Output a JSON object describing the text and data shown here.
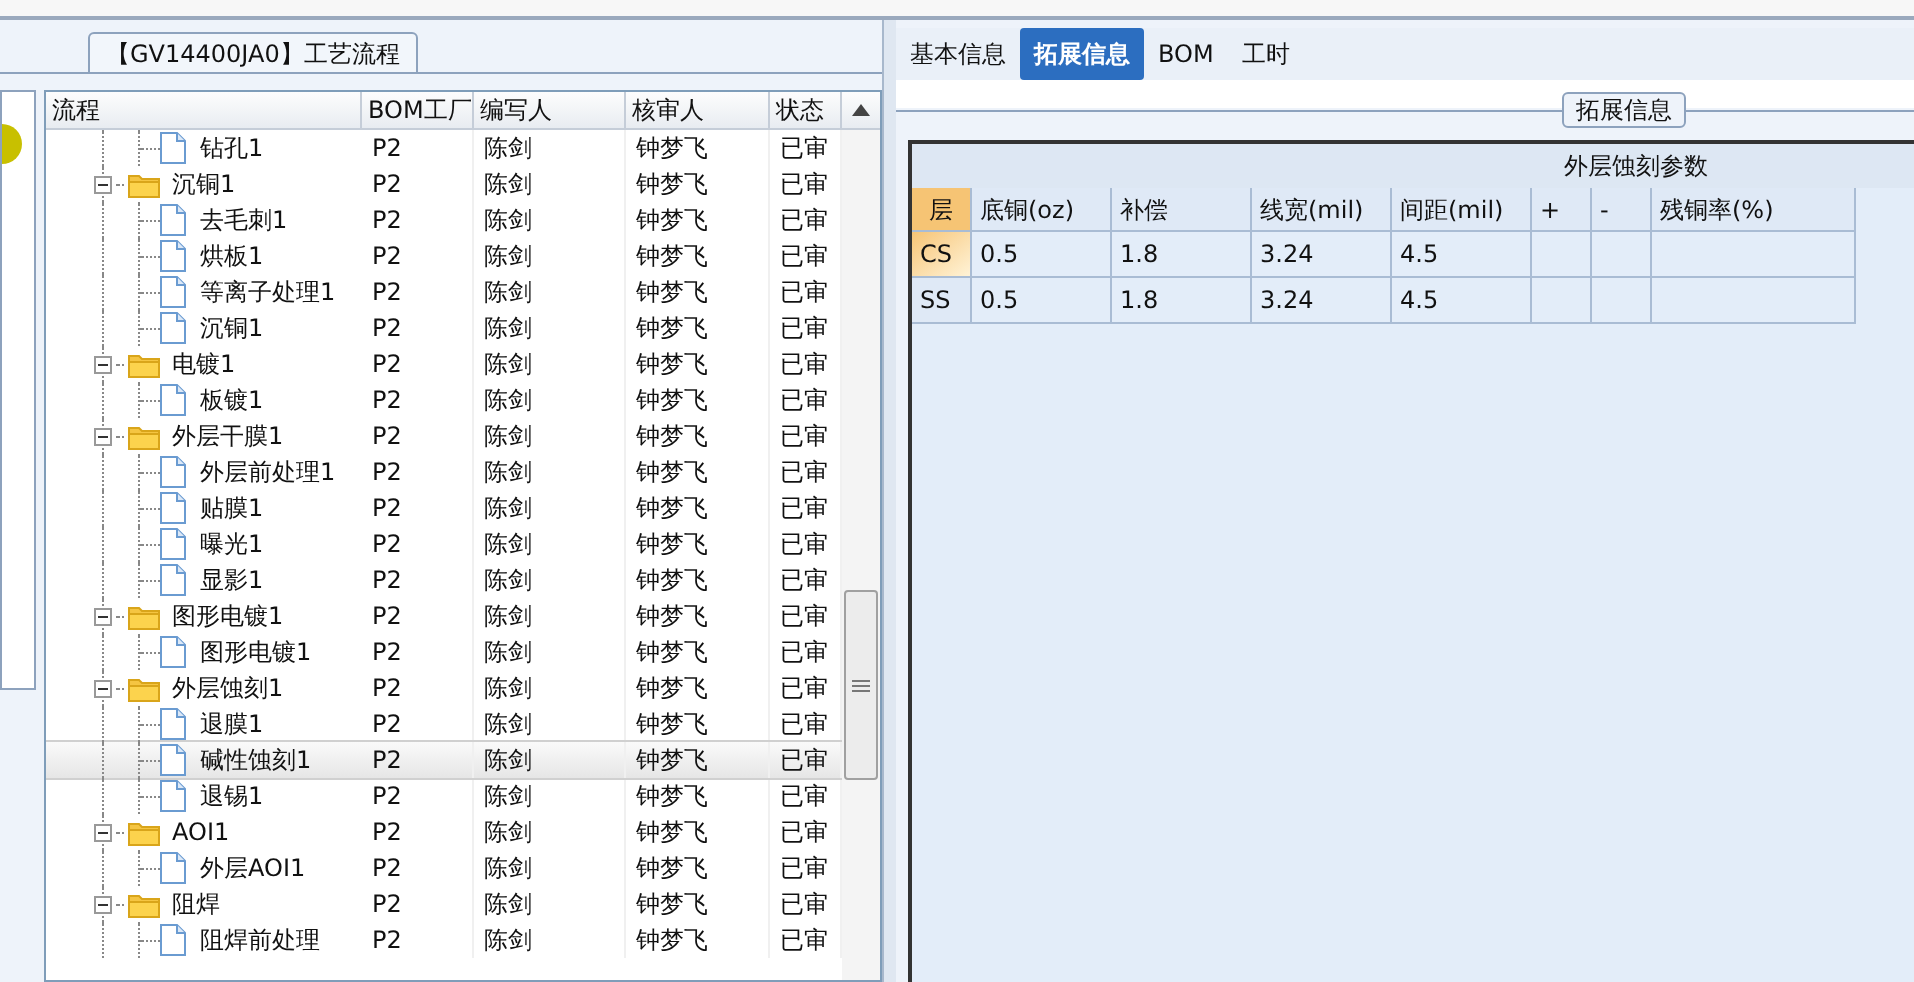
{
  "process_panel": {
    "title": "【GV14400JA0】工艺流程",
    "columns": [
      "流程",
      "BOM工厂",
      "编写人",
      "核审人",
      "状态"
    ],
    "rows": [
      {
        "kind": "continuation",
        "children": [
          {
            "kind": "file",
            "name": "钻孔1",
            "bom_factory": "P2",
            "author": "陈剑",
            "reviewer": "钟梦飞",
            "status": "已审",
            "selected": false
          }
        ]
      },
      {
        "kind": "folder",
        "name": "沉铜1",
        "bom_factory": "P2",
        "author": "陈剑",
        "reviewer": "钟梦飞",
        "status": "已审",
        "expanded": true,
        "selected": false,
        "children": [
          {
            "kind": "file",
            "name": "去毛刺1",
            "bom_factory": "P2",
            "author": "陈剑",
            "reviewer": "钟梦飞",
            "status": "已审",
            "selected": false
          },
          {
            "kind": "file",
            "name": "烘板1",
            "bom_factory": "P2",
            "author": "陈剑",
            "reviewer": "钟梦飞",
            "status": "已审",
            "selected": false
          },
          {
            "kind": "file",
            "name": "等离子处理1",
            "bom_factory": "P2",
            "author": "陈剑",
            "reviewer": "钟梦飞",
            "status": "已审",
            "selected": false
          },
          {
            "kind": "file",
            "name": "沉铜1",
            "bom_factory": "P2",
            "author": "陈剑",
            "reviewer": "钟梦飞",
            "status": "已审",
            "selected": false
          }
        ]
      },
      {
        "kind": "folder",
        "name": "电镀1",
        "bom_factory": "P2",
        "author": "陈剑",
        "reviewer": "钟梦飞",
        "status": "已审",
        "expanded": true,
        "selected": false,
        "children": [
          {
            "kind": "file",
            "name": "板镀1",
            "bom_factory": "P2",
            "author": "陈剑",
            "reviewer": "钟梦飞",
            "status": "已审",
            "selected": false
          }
        ]
      },
      {
        "kind": "folder",
        "name": "外层干膜1",
        "bom_factory": "P2",
        "author": "陈剑",
        "reviewer": "钟梦飞",
        "status": "已审",
        "expanded": true,
        "selected": false,
        "children": [
          {
            "kind": "file",
            "name": "外层前处理1",
            "bom_factory": "P2",
            "author": "陈剑",
            "reviewer": "钟梦飞",
            "status": "已审",
            "selected": false
          },
          {
            "kind": "file",
            "name": "贴膜1",
            "bom_factory": "P2",
            "author": "陈剑",
            "reviewer": "钟梦飞",
            "status": "已审",
            "selected": false
          },
          {
            "kind": "file",
            "name": "曝光1",
            "bom_factory": "P2",
            "author": "陈剑",
            "reviewer": "钟梦飞",
            "status": "已审",
            "selected": false
          },
          {
            "kind": "file",
            "name": "显影1",
            "bom_factory": "P2",
            "author": "陈剑",
            "reviewer": "钟梦飞",
            "status": "已审",
            "selected": false
          }
        ]
      },
      {
        "kind": "folder",
        "name": "图形电镀1",
        "bom_factory": "P2",
        "author": "陈剑",
        "reviewer": "钟梦飞",
        "status": "已审",
        "expanded": true,
        "selected": false,
        "children": [
          {
            "kind": "file",
            "name": "图形电镀1",
            "bom_factory": "P2",
            "author": "陈剑",
            "reviewer": "钟梦飞",
            "status": "已审",
            "selected": false
          }
        ]
      },
      {
        "kind": "folder",
        "name": "外层蚀刻1",
        "bom_factory": "P2",
        "author": "陈剑",
        "reviewer": "钟梦飞",
        "status": "已审",
        "expanded": true,
        "selected": false,
        "children": [
          {
            "kind": "file",
            "name": "退膜1",
            "bom_factory": "P2",
            "author": "陈剑",
            "reviewer": "钟梦飞",
            "status": "已审",
            "selected": false
          },
          {
            "kind": "file",
            "name": "碱性蚀刻1",
            "bom_factory": "P2",
            "author": "陈剑",
            "reviewer": "钟梦飞",
            "status": "已审",
            "selected": true
          },
          {
            "kind": "file",
            "name": "退锡1",
            "bom_factory": "P2",
            "author": "陈剑",
            "reviewer": "钟梦飞",
            "status": "已审",
            "selected": false
          }
        ]
      },
      {
        "kind": "folder",
        "name": "AOI1",
        "bom_factory": "P2",
        "author": "陈剑",
        "reviewer": "钟梦飞",
        "status": "已审",
        "expanded": true,
        "selected": false,
        "children": [
          {
            "kind": "file",
            "name": "外层AOI1",
            "bom_factory": "P2",
            "author": "陈剑",
            "reviewer": "钟梦飞",
            "status": "已审",
            "selected": false
          }
        ]
      },
      {
        "kind": "folder",
        "name": "阻焊",
        "bom_factory": "P2",
        "author": "陈剑",
        "reviewer": "钟梦飞",
        "status": "已审",
        "expanded": true,
        "selected": false,
        "children": [
          {
            "kind": "file",
            "name": "阻焊前处理",
            "bom_factory": "P2",
            "author": "陈剑",
            "reviewer": "钟梦飞",
            "status": "已审",
            "selected": false
          }
        ]
      }
    ]
  },
  "tabs": [
    {
      "label": "基本信息",
      "selected": false
    },
    {
      "label": "拓展信息",
      "selected": true
    },
    {
      "label": "BOM",
      "selected": false
    },
    {
      "label": "工时",
      "selected": false
    }
  ],
  "details": {
    "group_title": "拓展信息",
    "table_title": "外层蚀刻参数",
    "columns": [
      "层",
      "底铜(oz)",
      "补偿",
      "线宽(mil)",
      "间距(mil)",
      "+",
      "-",
      "残铜率(%)"
    ],
    "rows": [
      {
        "selected": true,
        "cells": [
          "CS",
          "0.5",
          "1.8",
          "3.24",
          "4.5",
          "",
          "",
          ""
        ]
      },
      {
        "selected": false,
        "cells": [
          "SS",
          "0.5",
          "1.8",
          "3.24",
          "4.5",
          "",
          "",
          ""
        ]
      }
    ]
  }
}
